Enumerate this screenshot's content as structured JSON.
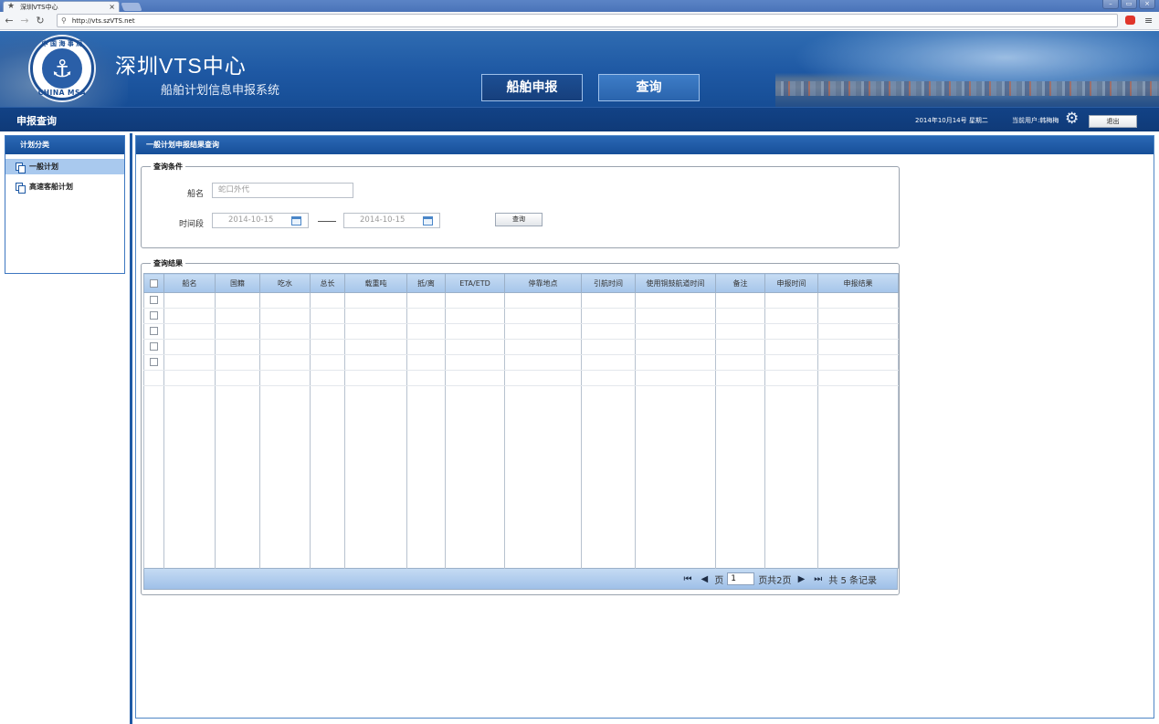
{
  "browser": {
    "tab_title": "深圳VTS中心",
    "tab_close": "×",
    "url": "http://vts.szVTS.net",
    "win_buttons": [
      "–",
      "▭",
      "×"
    ]
  },
  "header": {
    "logo_top_text": "中 国 海 事 局",
    "logo_bottom_text": "CHINA MSA",
    "title": "深圳VTS中心",
    "subtitle": "船舶计划信息申报系统",
    "nav_tabs": [
      "船舶申报",
      "查询"
    ]
  },
  "subbar": {
    "page_name": "申报查询",
    "date": "2014年10月14号  星期二",
    "current_user": "当前用户:韩梅梅",
    "logout_label": "退出"
  },
  "sidebar": {
    "heading": "计划分类",
    "items": [
      {
        "label": "一般计划",
        "selected": true
      },
      {
        "label": "高速客船计划",
        "selected": false
      }
    ]
  },
  "main": {
    "heading": "一般计划申报结果查询",
    "query": {
      "legend": "查询条件",
      "ship_name_label": "船名",
      "ship_name_placeholder": "蛇口外代",
      "period_label": "时间段",
      "date_from": "2014-10-15",
      "date_to": "2014-10-15",
      "search_label": "查询"
    },
    "results": {
      "legend": "查询结果",
      "columns": [
        "船名",
        "国籍",
        "吃水",
        "总长",
        "载重吨",
        "抵/离",
        "ETA/ETD",
        "停靠地点",
        "引航时间",
        "使用铜鼓航道时间",
        "备注",
        "申报时间",
        "申报结果"
      ],
      "checkbox_rows": 5
    },
    "pager": {
      "page_label": "页",
      "current_page": "1",
      "total_text": "页共2页",
      "record_text": "共 5 条记录"
    }
  },
  "colors": {
    "brand_blue": "#1e58a3",
    "header_gradient_top": "#2a68b5",
    "selected_item": "#a9c9ee"
  }
}
